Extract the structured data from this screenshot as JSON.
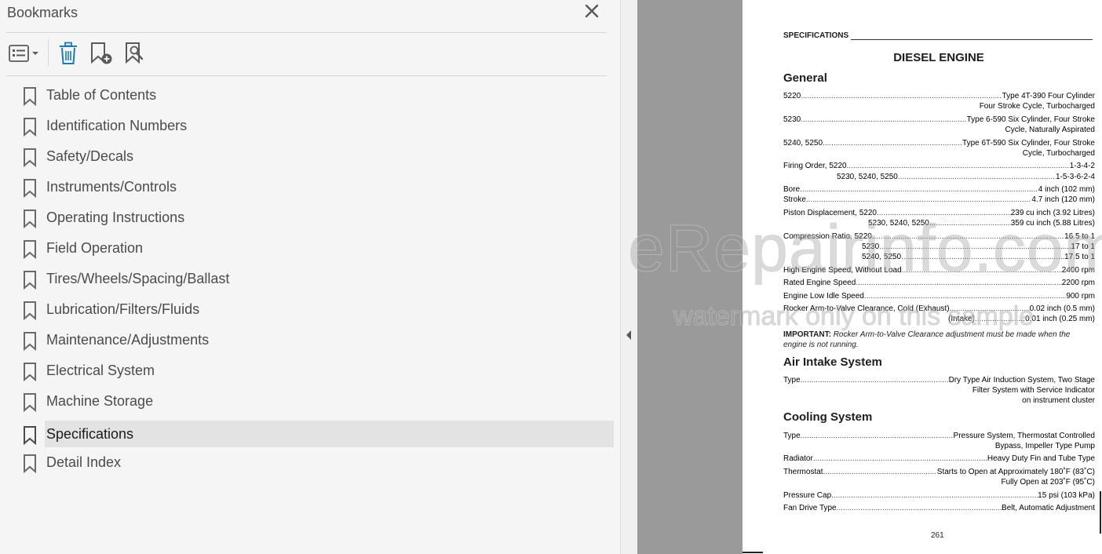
{
  "panel": {
    "title": "Bookmarks",
    "bookmarks": [
      {
        "label": "Table of Contents"
      },
      {
        "label": "Identification Numbers"
      },
      {
        "label": "Safety/Decals"
      },
      {
        "label": "Instruments/Controls"
      },
      {
        "label": "Operating Instructions"
      },
      {
        "label": "Field Operation"
      },
      {
        "label": "Tires/Wheels/Spacing/Ballast"
      },
      {
        "label": "Lubrication/Filters/Fluids"
      },
      {
        "label": "Maintenance/Adjustments"
      },
      {
        "label": "Electrical System"
      },
      {
        "label": "Machine Storage"
      },
      {
        "label": "Specifications"
      },
      {
        "label": "Detail Index"
      }
    ],
    "selected": "Specifications"
  },
  "document": {
    "header": "SPECIFICATIONS",
    "title": "DIESEL ENGINE",
    "general_heading": "General",
    "general": {
      "r1_label": "5220",
      "r1_value": "Type 4T-390 Four Cylinder",
      "r1_cont": "Four Stroke Cycle, Turbocharged",
      "r2_label": "5230",
      "r2_value": "Type 6-590 Six Cylinder, Four Stroke",
      "r2_cont": "Cycle, Naturally Aspirated",
      "r3_label": "5240, 5250",
      "r3_value": "Type 6T-590 Six Cylinder, Four Stroke",
      "r3_cont": "Cycle, Turbocharged",
      "r4_label": "Firing Order, 5220",
      "r4_value": "1-3-4-2",
      "r5_label": "5230, 5240, 5250",
      "r5_value": "1-5-3-6-2-4",
      "r6_label": "Bore",
      "r6_value": "4 inch (102 mm)",
      "r7_label": "Stroke",
      "r7_value": "4.7 inch (120 mm)",
      "r8_label": "Piston Displacement, 5220",
      "r8_value": "239 cu inch (3.92 Litres)",
      "r9_label": "5230, 5240, 5250",
      "r9_value": "359 cu inch (5.88 Litres)",
      "r10_label": "Compression Ratio, 5220",
      "r10_value": "16.5 to 1",
      "r11_label": "5230",
      "r11_value": "17 to 1",
      "r12_label": "5240, 5250",
      "r12_value": "17.5 to 1",
      "r13_label": "High Engine Speed, Without Load",
      "r13_value": "2400 rpm",
      "r14_label": "Rated Engine Speed",
      "r14_value": "2200 rpm",
      "r15_label": "Engine Low Idle Speed",
      "r15_value": "900 rpm",
      "r16_label": "Rocker Arm-to-Valve Clearance, Cold (Exhaust)",
      "r16_value": "0.02 inch (0.5 mm)",
      "r17_label": "(Intake)",
      "r17_value": "0.01 inch (0.25 mm)"
    },
    "important_label": "IMPORTANT:",
    "important_text": "Rocker Arm-to-Valve Clearance adjustment must be made when the engine is not running.",
    "air_heading": "Air Intake System",
    "air": {
      "r1_label": "Type",
      "r1_value": "Dry Type Air Induction System, Two Stage",
      "r1_cont1": "Filter System with Service Indicator",
      "r1_cont2": "on instrument cluster"
    },
    "cooling_heading": "Cooling System",
    "cooling": {
      "r1_label": "Type",
      "r1_value": "Pressure System, Thermostat Controlled",
      "r1_cont": "Bypass, Impeller Type Pump",
      "r2_label": "Radiator",
      "r2_value": "Heavy Duty Fin and Tube Type",
      "r3_label": "Thermostat",
      "r3_value": "Starts to Open at Approximately 180˚F (83˚C)",
      "r3_cont": "Fully Open at 203˚F (95˚C)",
      "r4_label": "Pressure Cap",
      "r4_value": "15 psi (103 kPa)",
      "r5_label": "Fan Drive Type",
      "r5_value": "Belt, Automatic Adjustment"
    },
    "page_number": "261"
  },
  "watermark": {
    "line1": "eRepairinfo.com",
    "line2": "watermark only on this sample"
  },
  "colors": {
    "panel_bg": "#f5f5f5",
    "selected_bg": "#e3e3e3",
    "gutter": "#9a9a9a",
    "icon_gray": "#6a6a6a"
  }
}
